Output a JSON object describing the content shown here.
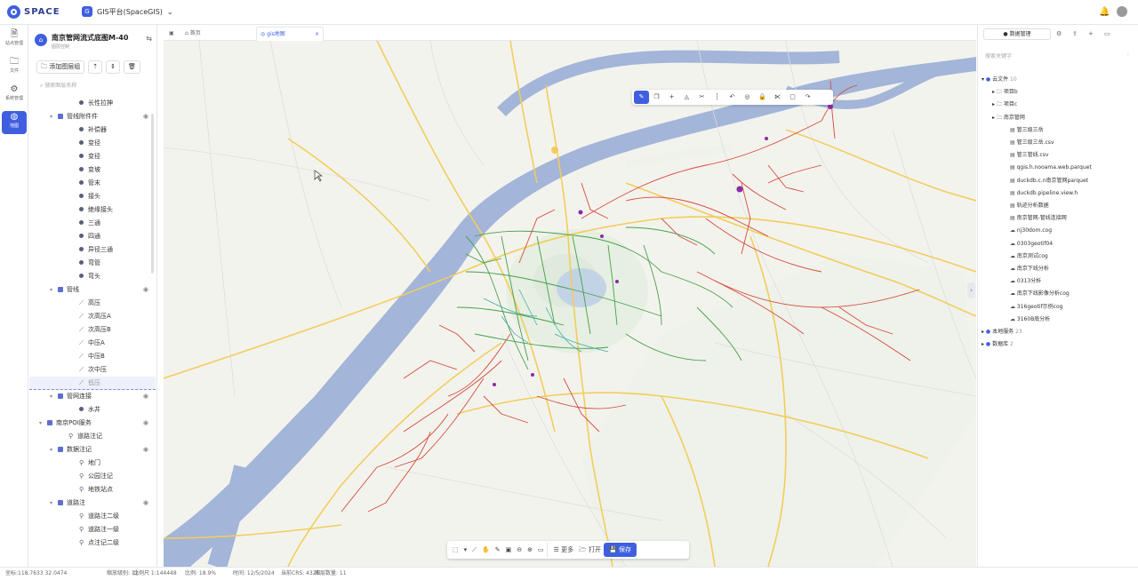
{
  "app": {
    "logo_text": "SPACE",
    "project_name": "GIS平台(SpaceGIS)"
  },
  "rail": [
    {
      "label": "站点管理",
      "icon": "file-icon"
    },
    {
      "label": "文件",
      "icon": "folder-icon"
    },
    {
      "label": "系统管理",
      "icon": "gear-icon"
    },
    {
      "label": "地图",
      "icon": "globe-icon"
    }
  ],
  "tree": {
    "title": "南京管网流式底图M-40",
    "subtitle": "图层控制",
    "add_group_label": "添加图层组",
    "search_placeholder": "搜索图层名称",
    "rows": [
      {
        "level": 3,
        "type": "point",
        "label": "长性拉抻",
        "eye": false
      },
      {
        "level": 1,
        "type": "group",
        "label": "管线附件件",
        "eye": true,
        "expanded": true
      },
      {
        "level": 3,
        "type": "point",
        "label": "补偿器",
        "eye": false
      },
      {
        "level": 3,
        "type": "point",
        "label": "变径",
        "eye": false
      },
      {
        "level": 3,
        "type": "point",
        "label": "变径",
        "eye": false
      },
      {
        "level": 3,
        "type": "point",
        "label": "变坡",
        "eye": false
      },
      {
        "level": 3,
        "type": "point",
        "label": "管末",
        "eye": false
      },
      {
        "level": 3,
        "type": "point",
        "label": "接头",
        "eye": false
      },
      {
        "level": 3,
        "type": "point",
        "label": "绝缘接头",
        "eye": false
      },
      {
        "level": 3,
        "type": "point",
        "label": "三通",
        "eye": false
      },
      {
        "level": 3,
        "type": "point",
        "label": "四通",
        "eye": false
      },
      {
        "level": 3,
        "type": "point",
        "label": "异径三通",
        "eye": false
      },
      {
        "level": 3,
        "type": "point",
        "label": "弯管",
        "eye": false
      },
      {
        "level": 3,
        "type": "point",
        "label": "弯头",
        "eye": false
      },
      {
        "level": 1,
        "type": "group",
        "label": "管线",
        "eye": true,
        "expanded": true
      },
      {
        "level": 3,
        "type": "line",
        "label": "高压",
        "eye": false
      },
      {
        "level": 3,
        "type": "line",
        "label": "次高压A",
        "eye": false
      },
      {
        "level": 3,
        "type": "line",
        "label": "次高压B",
        "eye": false
      },
      {
        "level": 3,
        "type": "line",
        "label": "中压A",
        "eye": false
      },
      {
        "level": 3,
        "type": "line",
        "label": "中压B",
        "eye": false
      },
      {
        "level": 3,
        "type": "line",
        "label": "次中压",
        "eye": false
      },
      {
        "level": 3,
        "type": "line",
        "label": "低压",
        "eye": false,
        "selected": true
      },
      {
        "level": 1,
        "type": "group",
        "label": "管网连接",
        "eye": true,
        "expanded": true
      },
      {
        "level": 3,
        "type": "point",
        "label": "水井",
        "eye": false
      },
      {
        "level": 0,
        "type": "group",
        "label": "南京POI服务",
        "eye": true,
        "expanded": true
      },
      {
        "level": 2,
        "type": "poi",
        "label": "道路注记",
        "eye": false
      },
      {
        "level": 1,
        "type": "group",
        "label": "数据注记",
        "eye": true,
        "expanded": true
      },
      {
        "level": 3,
        "type": "poi",
        "label": "地门",
        "eye": false
      },
      {
        "level": 3,
        "type": "poi",
        "label": "公园注记",
        "eye": false
      },
      {
        "level": 3,
        "type": "poi",
        "label": "地铁站点",
        "eye": false
      },
      {
        "level": 1,
        "type": "group",
        "label": "道路注",
        "eye": true,
        "expanded": true
      },
      {
        "level": 3,
        "type": "poi",
        "label": "道路注二级",
        "eye": false
      },
      {
        "level": 3,
        "type": "poi",
        "label": "道路注一级",
        "eye": false
      },
      {
        "level": 3,
        "type": "poi",
        "label": "点注记二级",
        "eye": false
      }
    ]
  },
  "tabs": [
    {
      "label": "首页",
      "icon": "home-icon",
      "active": false
    },
    {
      "label": "gis地图",
      "icon": "globe-icon",
      "active": true
    }
  ],
  "map_toolbar": [
    "pen-icon",
    "copy-icon",
    "plus-icon",
    "paint-icon",
    "scissors-icon",
    "dash-icon",
    "undo-icon",
    "target-icon",
    "lock-icon",
    "scissor-alt-icon",
    "copy-alt-icon",
    "redo-icon"
  ],
  "bottom_toolbar": [
    {
      "label": "",
      "icon": "select-icon"
    },
    {
      "label": "",
      "icon": "dropdown-icon"
    },
    {
      "label": "",
      "icon": "ruler-icon"
    },
    {
      "label": "",
      "icon": "hand-icon"
    },
    {
      "label": "",
      "icon": "brush-icon"
    },
    {
      "label": "",
      "icon": "box-icon"
    },
    {
      "label": "",
      "icon": "zoom-out-icon"
    },
    {
      "label": "",
      "icon": "zoom-in-icon"
    },
    {
      "label": "",
      "icon": "screen-icon"
    },
    {
      "label": "更多",
      "icon": "menu-icon"
    },
    {
      "label": "打开",
      "icon": "open-icon"
    },
    {
      "label": "保存",
      "icon": "save-icon"
    }
  ],
  "right": {
    "tab_label": "数据管理",
    "search_placeholder": "搜索关键字",
    "rows": [
      {
        "level": 0,
        "icon": "dot",
        "label": "云文件",
        "count": "10",
        "expand": "▾"
      },
      {
        "level": 1,
        "icon": "folder",
        "label": "项目b",
        "expand": "▸"
      },
      {
        "level": 1,
        "icon": "folder",
        "label": "项目c",
        "expand": "▸"
      },
      {
        "level": 1,
        "icon": "folder",
        "label": "南京管网",
        "expand": "▸"
      },
      {
        "level": 2,
        "icon": "file",
        "label": "管三级三岳"
      },
      {
        "level": 2,
        "icon": "file",
        "label": "管三级三岳.csv"
      },
      {
        "level": 2,
        "icon": "file",
        "label": "管三管线.csv"
      },
      {
        "level": 2,
        "icon": "file",
        "label": "qgis.h.nooama.web.parquet"
      },
      {
        "level": 2,
        "icon": "file",
        "label": "duckdb.c.n南京管网parquet"
      },
      {
        "level": 2,
        "icon": "file",
        "label": "duckdb.pipeline.view.h"
      },
      {
        "level": 2,
        "icon": "file",
        "label": "轨迹分析数据"
      },
      {
        "level": 2,
        "icon": "file",
        "label": "南京管网-管线连接网"
      },
      {
        "level": 2,
        "icon": "cloud",
        "label": "nj30dom.cog"
      },
      {
        "level": 2,
        "icon": "cloud",
        "label": "0303geotif04"
      },
      {
        "level": 2,
        "icon": "cloud",
        "label": "南京测试cog"
      },
      {
        "level": 2,
        "icon": "cloud",
        "label": "南京下线分析"
      },
      {
        "level": 2,
        "icon": "cloud",
        "label": "0313分析"
      },
      {
        "level": 2,
        "icon": "cloud",
        "label": "南京下线影像分析cog"
      },
      {
        "level": 2,
        "icon": "cloud",
        "label": "316geotif示例cog"
      },
      {
        "level": 2,
        "icon": "cloud",
        "label": "3160B底分析"
      },
      {
        "level": 0,
        "icon": "dot",
        "label": "本地服务",
        "count": "23",
        "expand": "▸"
      },
      {
        "level": 0,
        "icon": "dot",
        "label": "数据库",
        "count": "2",
        "expand": "▸"
      }
    ]
  },
  "status": [
    "坐标:118.7633 32.0474",
    "缩放级别: 12",
    "比例尺 1:144448",
    "比例: 18.9%",
    "时间: 12/5/2024",
    "当前CRS: 4326",
    "图层数量: 11"
  ],
  "colors": {
    "accent": "#3f5fe0",
    "water": "#9cb0d6",
    "road_yellow": "#f2c94c",
    "pipe_red": "#d44a3a",
    "pipe_green": "#3f9e4a",
    "pipe_teal": "#3fa8a8"
  }
}
